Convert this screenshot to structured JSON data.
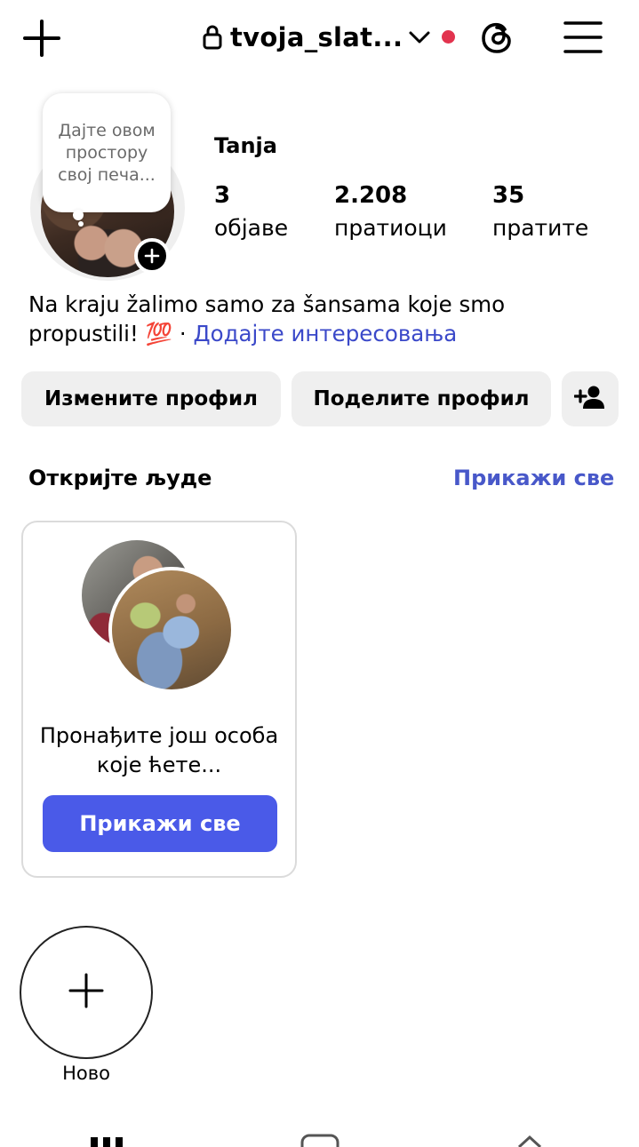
{
  "header": {
    "username": "tvoja_slat...",
    "icons": [
      "plus-icon",
      "lock-icon",
      "chevron-down-icon",
      "notification-dot",
      "threads-icon",
      "menu-icon"
    ],
    "notification_color": "#e2334e"
  },
  "profile": {
    "note_bubble": "Дајте овом простору свој печа...",
    "name": "Tanja",
    "stats": [
      {
        "value": "3",
        "label": "објаве"
      },
      {
        "value": "2.208",
        "label": "пратиоци"
      },
      {
        "value": "35",
        "label": "пратите"
      }
    ],
    "bio_text": "Na kraju žalimo samo za šansama koje smo propustili! 💯 · ",
    "bio_link": "Додајте интересовања"
  },
  "actions": {
    "edit_profile": "Измените профил",
    "share_profile": "Поделите профил"
  },
  "discover": {
    "title": "Откријте људе",
    "show_all_link": "Прикажи све",
    "card_text": "Пронађите још особа које ћете...",
    "card_button": "Прикажи све"
  },
  "highlights": {
    "new_label": "Ново"
  },
  "colors": {
    "accent": "#4a5ae8",
    "link": "#3b49c9"
  }
}
